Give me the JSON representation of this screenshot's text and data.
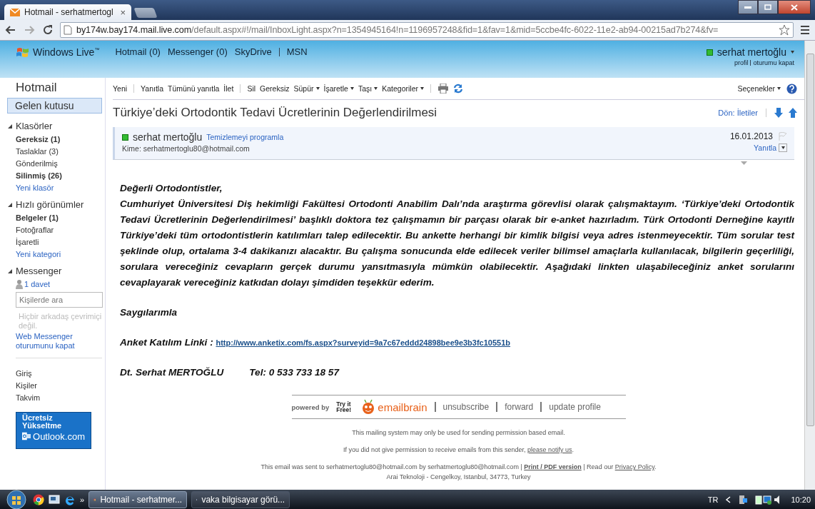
{
  "browser": {
    "tab_title": "Hotmail - serhatmertogl",
    "close": "×",
    "url_host": "by174w.bay174.mail.live.com",
    "url_path": "/default.aspx#!/mail/InboxLight.aspx?n=1354945164!n=1196957248&fid=1&fav=1&mid=5ccbe4fc-6022-11e2-ab94-00215ad7b274&fv="
  },
  "header": {
    "logo": "Windows Live",
    "logo_mark": "™",
    "nav": [
      {
        "label": "Hotmail (0)"
      },
      {
        "label": "Messenger (0)"
      },
      {
        "label": "SkyDrive"
      },
      {
        "label": "MSN"
      }
    ],
    "user": "serhat mertoğlu",
    "user_links": [
      "profil",
      "oturumu kapat"
    ]
  },
  "sidebar": {
    "title": "Hotmail",
    "inbox": {
      "label": "Gelen kutusu",
      "selected": true
    },
    "sections": [
      {
        "title": "Klasörler",
        "expanded": true,
        "items": [
          {
            "label": "Gereksiz (1)",
            "kind": "folder",
            "unread": true
          },
          {
            "label": "Taslaklar (3)",
            "kind": "folder",
            "unread": false
          },
          {
            "label": "Gönderilmiş",
            "kind": "folder",
            "unread": false
          },
          {
            "label": "Silinmiş (26)",
            "kind": "folder",
            "unread": true
          },
          {
            "label": "Yeni klasör",
            "kind": "link"
          }
        ]
      },
      {
        "title": "Hızlı görünümler",
        "expanded": true,
        "items": [
          {
            "label": "Belgeler (1)",
            "kind": "folder",
            "unread": true
          },
          {
            "label": "Fotoğraflar",
            "kind": "folder",
            "unread": false
          },
          {
            "label": "İşaretli",
            "kind": "folder",
            "unread": false
          },
          {
            "label": "Yeni kategori",
            "kind": "link"
          }
        ]
      }
    ],
    "messenger": {
      "title": "Messenger",
      "expanded": true,
      "invite": "1 davet",
      "search_placeholder": "Kişilerde ara",
      "status": "Hiçbir arkadaş çevrimiçi değil.",
      "signout_link": "Web Messenger oturumunu kapat"
    },
    "bottom_links": [
      "Giriş",
      "Kişiler",
      "Takvim"
    ],
    "ad": {
      "lines": [
        "Ücretsiz",
        "Yükseltme"
      ],
      "brand": "Outlook.com"
    }
  },
  "toolbar": {
    "groups": [
      [
        {
          "label": "Yeni",
          "dropdown": false
        }
      ],
      [
        {
          "label": "Yanıtla",
          "dropdown": false
        },
        {
          "label": "Tümünü yanıtla",
          "dropdown": false
        },
        {
          "label": "İlet",
          "dropdown": false
        }
      ],
      [
        {
          "label": "Sil",
          "dropdown": false
        },
        {
          "label": "Gereksiz",
          "dropdown": false
        },
        {
          "label": "Süpür",
          "dropdown": true
        },
        {
          "label": "İşaretle",
          "dropdown": true
        },
        {
          "label": "Taşı",
          "dropdown": true
        },
        {
          "label": "Kategoriler",
          "dropdown": true
        }
      ]
    ],
    "options": {
      "label": "Seçenekler",
      "dropdown": true
    }
  },
  "message": {
    "subject": "Türkiye’deki Ortodontik Tedavi Ücretlerinin Değerlendirilmesi",
    "back_link": "Dön: İletiler",
    "sender": "serhat mertoğlu",
    "sender_online": true,
    "schedule_link": "Temizlemeyi programla",
    "to": "Kime: serhatmertoglu80@hotmail.com",
    "date": "16.01.2013",
    "reply": "Yanıtla"
  },
  "body": {
    "greeting": "Değerli Ortodontistler,",
    "paragraph": "Cumhuriyet Üniversitesi Diş hekimliği Fakültesi Ortodonti Anabilim Dalı’nda araştırma görevlisi olarak çalışmaktayım. ‘Türkiye’deki Ortodontik Tedavi Ücretlerinin Değerlendirilmesi’ başlıklı doktora tez çalışmamın bir parçası olarak bir e-anket hazırladım. Türk Ortodonti Derneğine kayıtlı Türkiye’deki tüm ortodontistlerin katılımları talep edilecektir. Bu ankette herhangi bir kimlik bilgisi veya adres istenmeyecektir. Tüm sorular test şeklinde olup, ortalama 3-4 dakikanızı alacaktır. Bu çalışma sonucunda elde edilecek veriler bilimsel amaçlarla kullanılacak, bilgilerin geçerliliği, sorulara vereceğiniz cevapların gerçek durumu yansıtmasıyla mümkün olabilecektir. Aşağıdaki linkten ulaşabileceğiniz anket sorularını cevaplayarak vereceğiniz katkıdan dolayı şimdiden teşekkür ederim.",
    "closing": "Saygılarımla",
    "link_label": "Anket Katılım Linki :",
    "link": "http://www.anketix.com/fs.aspx?surveyid=9a7c67eddd24898bee9e3b3fc10551b",
    "signature": "Dt. Serhat MERTOĞLU",
    "phone": "Tel: 0 533 733 18 57"
  },
  "footer": {
    "powered_by": "powered by",
    "try_it": "Try it Free!",
    "brand": "emailbrain",
    "links": [
      "unsubscribe",
      "forward",
      "update profile"
    ],
    "notice": "This mailing system may only be used for sending permission based email.",
    "permission_text": "If you did not give permission to receive emails from this sender,",
    "permission_link": "please notify us",
    "permission_end": ".",
    "sent_text": "This email was sent to serhatmertoglu80@hotmail.com by serhatmertoglu80@hotmail.com |",
    "print_link": "Print / PDF version",
    "read_text": "| Read our",
    "privacy_link": "Privacy Policy",
    "sent_end": ".",
    "address": "Arai Teknoloji - Cengelkoy, Istanbul, 34773, Turkey"
  },
  "taskbar": {
    "overflow": "»",
    "windows": [
      {
        "label": "Hotmail - serhatmer...",
        "selected": true
      },
      {
        "label": "vaka bilgisayar görü...",
        "selected": false
      }
    ],
    "language": "TR",
    "clock": "10:20"
  }
}
